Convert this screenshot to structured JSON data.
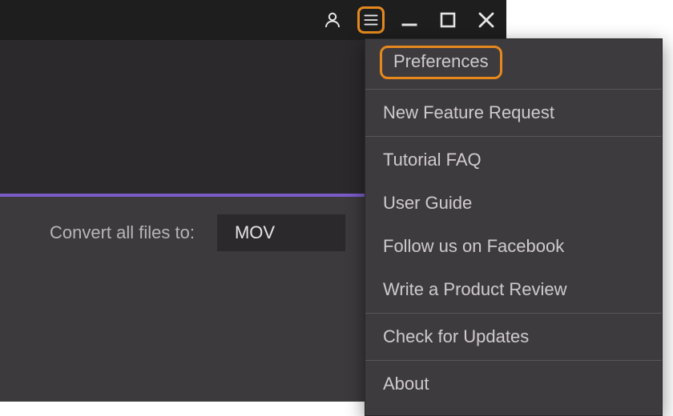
{
  "titlebar": {
    "user_icon": "user-icon",
    "menu_icon": "hamburger-icon",
    "min_icon": "minimize-icon",
    "max_icon": "maximize-icon",
    "close_icon": "close-icon"
  },
  "convert": {
    "label": "Convert all files to:",
    "selected_format": "MOV"
  },
  "menu": {
    "preferences": "Preferences",
    "new_feature_request": "New Feature Request",
    "tutorial_faq": "Tutorial FAQ",
    "user_guide": "User Guide",
    "follow_facebook": "Follow us on Facebook",
    "write_review": "Write a Product Review",
    "check_updates": "Check for Updates",
    "about": "About"
  },
  "highlight": {
    "color": "#e6891d"
  }
}
